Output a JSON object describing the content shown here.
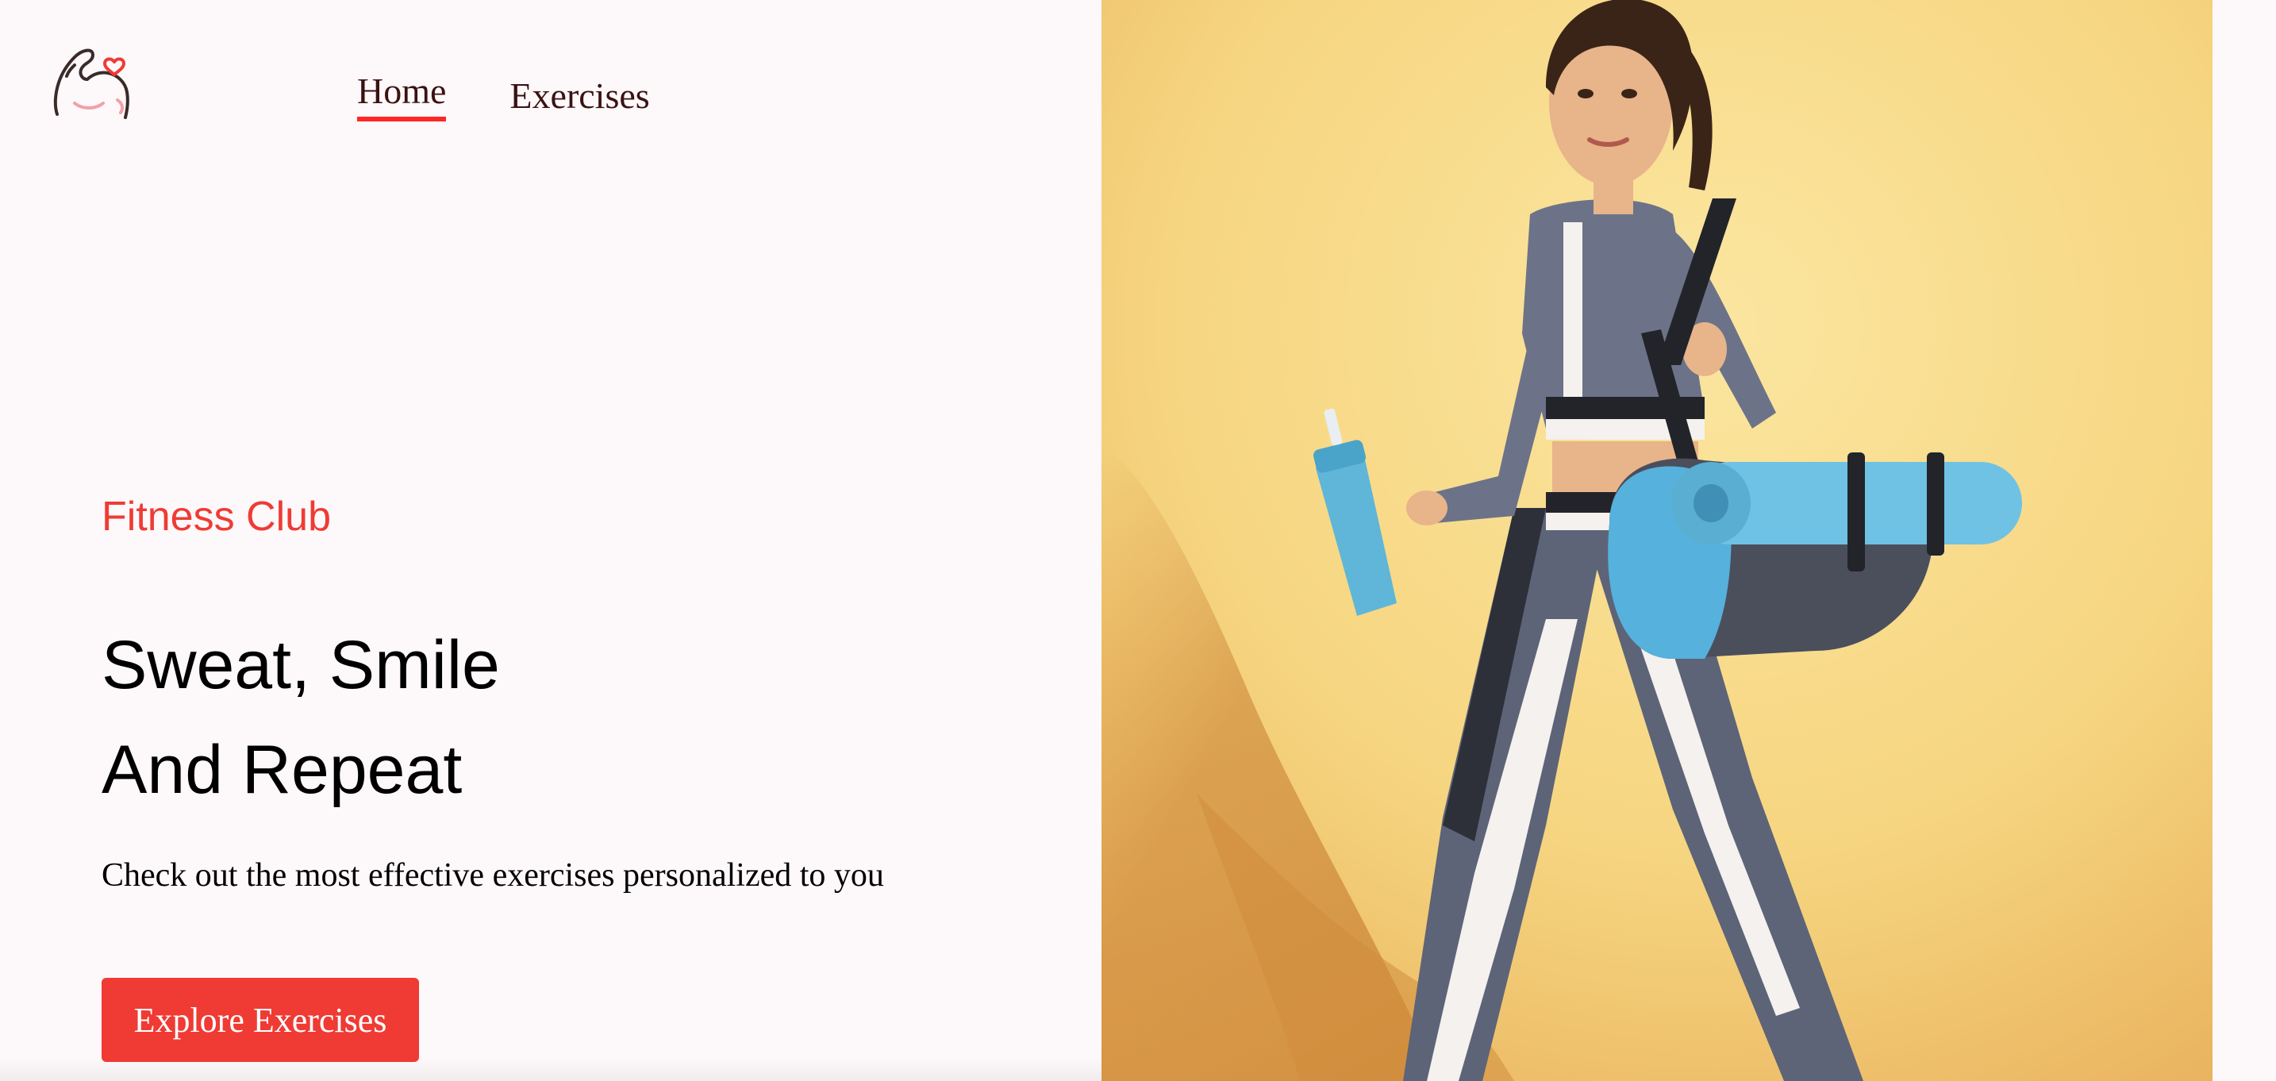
{
  "nav": {
    "items": [
      {
        "label": "Home",
        "active": true
      },
      {
        "label": "Exercises",
        "active": false
      }
    ]
  },
  "hero": {
    "tagline": "Fitness Club",
    "headline_line1": "Sweat, Smile",
    "headline_line2": "And Repeat",
    "subtext": "Check out the most effective exercises personalized to you",
    "cta_label": "Explore Exercises"
  },
  "colors": {
    "accent": "#ef3b34",
    "page_background": "#fdf8f9",
    "photo_background": "#f6d985"
  },
  "icons": {
    "logo": "flexed-arm-heart-icon"
  }
}
